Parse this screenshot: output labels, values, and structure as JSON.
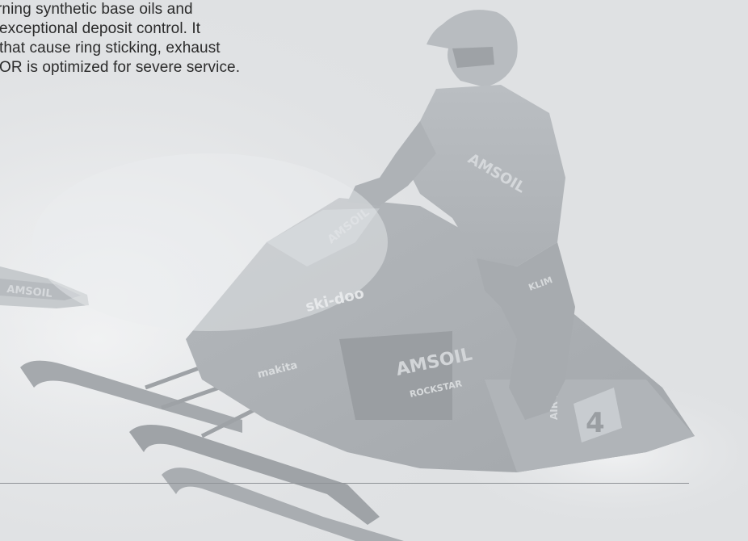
{
  "paragraph": {
    "lines": [
      "rning synthetic base oils and",
      "exceptional deposit control. It",
      "that cause ring sticking, exhaust",
      "OR is optimized for severe service."
    ]
  },
  "photo": {
    "sled_brand": "ski-doo",
    "sponsor_main": "AMSOIL",
    "sponsor_side": "AMSOIL",
    "sponsor_makita": "makita",
    "sponsor_rockstar": "ROCKSTAR",
    "sponsor_airforce": "AIR FORCE",
    "sponsor_klim": "KLIM",
    "race_number": "4",
    "palette": {
      "background": "#dfe1e3",
      "snow": "#eceeef",
      "sled_dark": "#a9adb1",
      "sled_mid": "#bfc3c7",
      "rider": "#b2b6ba"
    }
  }
}
